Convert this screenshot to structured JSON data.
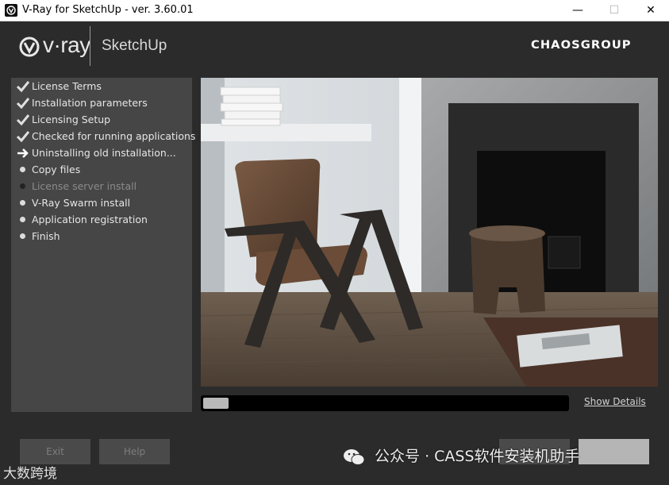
{
  "window": {
    "title": "V-Ray for SketchUp - ver. 3.60.01",
    "controls": {
      "minimize": "—",
      "maximize": "☐",
      "close": "✕"
    }
  },
  "header": {
    "vray_logo": "v·ray",
    "product": "SketchUp",
    "vendor_logo": "CHAOSGROUP"
  },
  "steps": [
    {
      "label": "License Terms",
      "state": "done",
      "icon": "checkmark-icon"
    },
    {
      "label": "Installation parameters",
      "state": "done",
      "icon": "checkmark-icon"
    },
    {
      "label": "Licensing Setup",
      "state": "done",
      "icon": "checkmark-icon"
    },
    {
      "label": "Checked for running applications",
      "state": "done",
      "icon": "checkmark-icon"
    },
    {
      "label": "Uninstalling old installation...",
      "state": "current",
      "icon": "arrow-right-icon"
    },
    {
      "label": "Copy files",
      "state": "pending",
      "icon": "bullet-icon"
    },
    {
      "label": "License server install",
      "state": "disabled",
      "icon": "bullet-icon"
    },
    {
      "label": "V-Ray Swarm install",
      "state": "pending",
      "icon": "bullet-icon"
    },
    {
      "label": "Application registration",
      "state": "pending",
      "icon": "bullet-icon"
    },
    {
      "label": "Finish",
      "state": "pending",
      "icon": "bullet-icon"
    }
  ],
  "progress": {
    "value": 0.07,
    "show_details": "Show Details"
  },
  "buttons": {
    "exit": "Exit",
    "help": "Help",
    "back": "",
    "next": ""
  },
  "watermark": {
    "main": "公众号 · CASS软件安装机助手",
    "corner": "大数跨境"
  },
  "colors": {
    "background": "#2b2b2b",
    "panel": "#464646",
    "progress_track": "#000000",
    "progress_fill": "#b9b9b9"
  }
}
